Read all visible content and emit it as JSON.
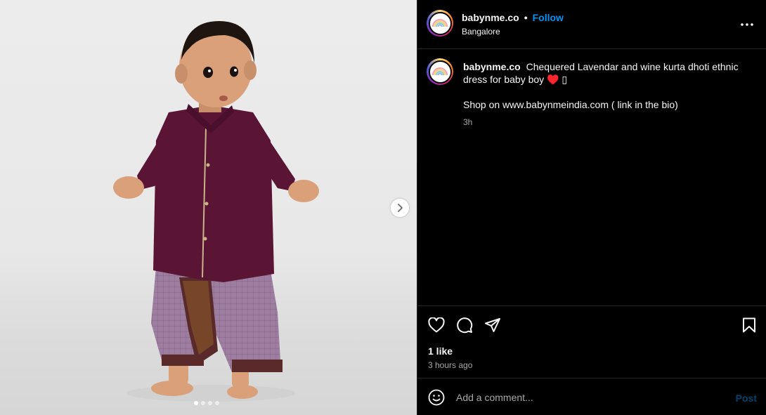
{
  "account": {
    "username": "babynme.co",
    "separator": "•",
    "follow_label": "Follow",
    "location": "Bangalore",
    "avatar_icon": "rainbow-logo"
  },
  "caption": {
    "username": "babynme.co",
    "text_line1": "Chequered Lavendar and wine kurta dhoti ethnic dress for baby boy",
    "emoji": "♥️",
    "emoji_trailing": "▯",
    "text_line2": "Shop on www.babynmeindia.com ( link in the bio)",
    "time": "3h"
  },
  "media": {
    "slide_count": 4,
    "active_slide": 1
  },
  "actions": {
    "like_icon": "heart-outline-icon",
    "comment_icon": "speech-bubble-icon",
    "share_icon": "paper-plane-icon",
    "save_icon": "bookmark-icon"
  },
  "likes_text": "1 like",
  "posted_ago": "3 hours ago",
  "comment": {
    "placeholder": "Add a comment...",
    "post_label": "Post"
  },
  "colors": {
    "accent": "#0095f6",
    "background": "#000000",
    "divider": "#262626",
    "muted_text": "#a8a8a8",
    "kurta": "#5a1535",
    "dhoti": "#9d7ea0"
  }
}
